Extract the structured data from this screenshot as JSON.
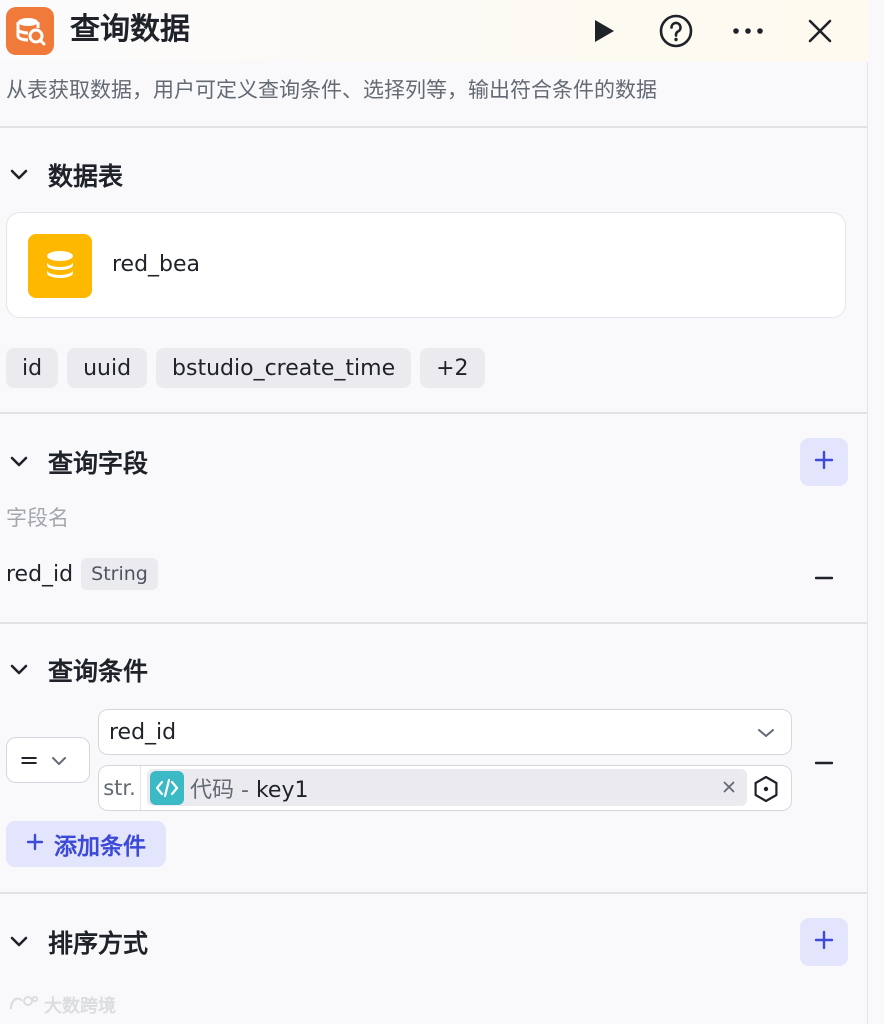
{
  "header": {
    "title": "查询数据",
    "description": "从表获取数据，用户可定义查询条件、选择列等，输出符合条件的数据",
    "icons": [
      "database-search-icon",
      "play-icon",
      "help-icon",
      "more-icon",
      "close-icon"
    ]
  },
  "data_table": {
    "section_label": "数据表",
    "table_name": "red_bea",
    "columns": [
      "id",
      "uuid",
      "bstudio_create_time",
      "+2"
    ]
  },
  "query_fields": {
    "section_label": "查询字段",
    "column_header": "字段名",
    "fields": [
      {
        "name": "red_id",
        "type": "String"
      }
    ]
  },
  "query_conditions": {
    "section_label": "查询条件",
    "conditions": [
      {
        "operator": "=",
        "field": "red_id",
        "value_type": "str.",
        "ref_source": "代码",
        "ref_separator": " - ",
        "ref_key": "key1"
      }
    ],
    "add_label": "添加条件"
  },
  "sort_order": {
    "section_label": "排序方式"
  },
  "watermark": {
    "text": "大数跨境"
  },
  "colors": {
    "accent": "#3d4ad8",
    "accent_bg": "#e3e5fd",
    "app_icon": "#f07a3a",
    "db_icon": "#ffb800",
    "code_icon": "#3bb9c4"
  }
}
